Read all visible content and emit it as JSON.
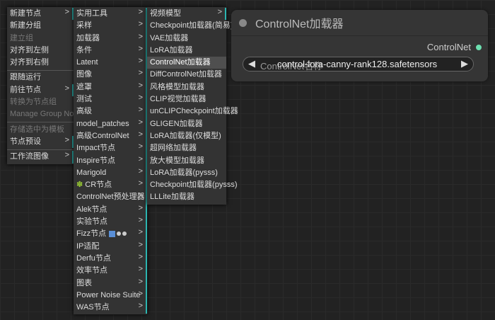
{
  "menu1": [
    {
      "label": "新建节点",
      "sub": true
    },
    {
      "label": "新建分组"
    },
    {
      "label": "建立组",
      "disabled": true
    },
    {
      "label": "对齐到左侧"
    },
    {
      "label": "对齐到右侧"
    },
    {
      "sep": true
    },
    {
      "label": "跟随运行"
    },
    {
      "label": "前往节点",
      "sub": true
    },
    {
      "label": "转换为节点组",
      "disabled": true
    },
    {
      "label": "Manage Group Nodes",
      "disabled": true
    },
    {
      "sep": true
    },
    {
      "label": "存储选中为模板",
      "disabled": true
    },
    {
      "label": "节点预设",
      "sub": true
    },
    {
      "sep": true
    },
    {
      "label": "工作流图像",
      "sub": true
    }
  ],
  "menu2": [
    {
      "label": "实用工具"
    },
    {
      "label": "采样"
    },
    {
      "label": "加载器"
    },
    {
      "label": "条件"
    },
    {
      "label": "Latent"
    },
    {
      "label": "图像"
    },
    {
      "label": "遮罩"
    },
    {
      "label": "测试"
    },
    {
      "label": "高级"
    },
    {
      "label": "model_patches"
    },
    {
      "label": "高级ControlNet"
    },
    {
      "label": "Impact节点"
    },
    {
      "label": "Inspire节点"
    },
    {
      "label": "Marigold"
    },
    {
      "label": "CR节点",
      "icon": "puzzle-icon"
    },
    {
      "label": "ControlNet预处理器"
    },
    {
      "label": "Alek节点"
    },
    {
      "label": "实验节点"
    },
    {
      "label": "Fizz节点",
      "icon": "fizz-icons"
    },
    {
      "label": "IP适配"
    },
    {
      "label": "Derfu节点"
    },
    {
      "label": "效率节点"
    },
    {
      "label": "图表"
    },
    {
      "label": "Power Noise Suite"
    },
    {
      "label": "WAS节点"
    }
  ],
  "menu3": [
    {
      "label": "视频模型",
      "sub": true
    },
    {
      "label": "Checkpoint加载器(简易)"
    },
    {
      "label": "VAE加载器"
    },
    {
      "label": "LoRA加载器"
    },
    {
      "label": "ControlNet加载器",
      "highlighted": true
    },
    {
      "label": "DiffControlNet加载器"
    },
    {
      "label": "风格模型加载器"
    },
    {
      "label": "CLIP视觉加载器"
    },
    {
      "label": "unCLIPCheckpoint加载器"
    },
    {
      "label": "GLIGEN加载器"
    },
    {
      "label": "LoRA加载器(仅模型)"
    },
    {
      "label": "超网络加载器"
    },
    {
      "label": "放大模型加载器"
    },
    {
      "label": "LoRA加载器(pysss)"
    },
    {
      "label": "Checkpoint加载器(pysss)"
    },
    {
      "label": "LLLite加载器"
    }
  ],
  "arrow": ">",
  "node": {
    "title": "ControlNet加载器",
    "output": "ControlNet",
    "widget_label": "ControlNet名称",
    "widget_value": "control-lora-canny-rank128.safetensors",
    "left": "◀",
    "right": "▶"
  },
  "colors": {
    "accent": "#2bb5b0",
    "output_dot": "#6de0b0"
  }
}
